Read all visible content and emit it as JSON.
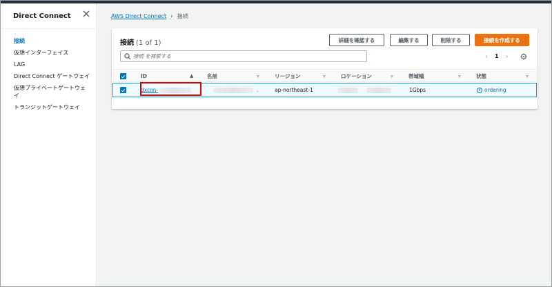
{
  "sidebar": {
    "title": "Direct Connect",
    "items": [
      {
        "label": "接続",
        "active": true
      },
      {
        "label": "仮想インターフェイス"
      },
      {
        "label": "LAG"
      },
      {
        "label": "Direct Connect ゲートウェイ"
      },
      {
        "label": "仮想プライベートゲートウェ"
      },
      {
        "label": "イ"
      },
      {
        "label": "トランジットゲートウェイ"
      }
    ]
  },
  "breadcrumb": {
    "root": "AWS Direct Connect",
    "current": "接続"
  },
  "panel": {
    "title": "接続",
    "count": "(1 of 1)",
    "buttons": {
      "details": "詳細を確認する",
      "edit": "編集する",
      "delete": "削除する",
      "create": "接続を作成する"
    },
    "search_placeholder": "接続 を検索する",
    "page": "1"
  },
  "table": {
    "columns": [
      "ID",
      "名前",
      "リージョン",
      "ロケーション",
      "帯域幅",
      "状態"
    ],
    "rows": [
      {
        "id": "dxcon-",
        "name": ".",
        "region": "ap-northeast-1",
        "bandwidth": "1Gbps",
        "status": "ordering"
      }
    ]
  },
  "colors": {
    "link": "#0073bb",
    "primary_button": "#ec7211",
    "highlight": "#e00000"
  }
}
